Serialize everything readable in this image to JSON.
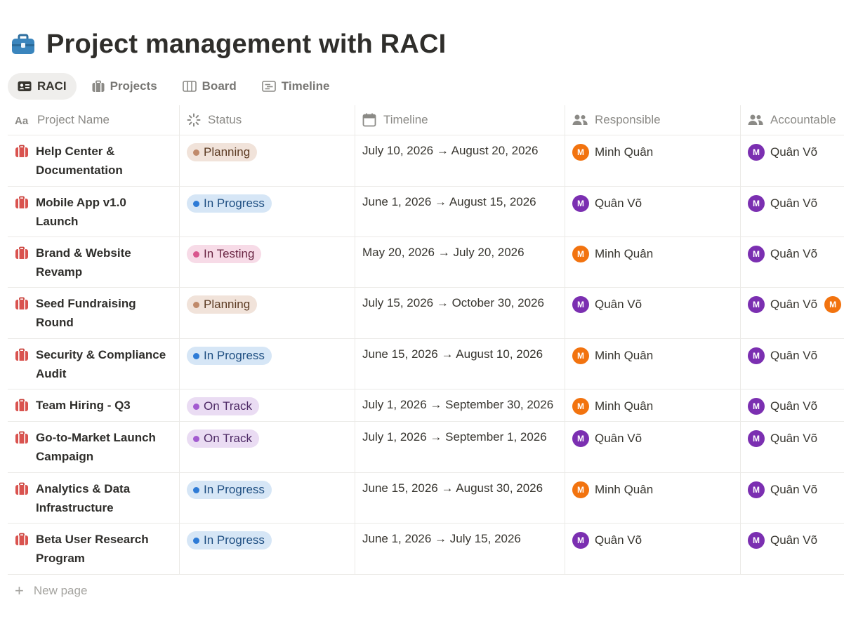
{
  "page": {
    "title": "Project management with RACI",
    "icon": "briefcase-icon"
  },
  "tabs": [
    {
      "label": "RACI",
      "icon": "id-card-icon",
      "active": true
    },
    {
      "label": "Projects",
      "icon": "briefcase-icon",
      "active": false
    },
    {
      "label": "Board",
      "icon": "board-columns-icon",
      "active": false
    },
    {
      "label": "Timeline",
      "icon": "timeline-icon",
      "active": false
    }
  ],
  "columns": [
    {
      "label": "Project Name",
      "icon": "text-aa-icon"
    },
    {
      "label": "Status",
      "icon": "status-loader-icon"
    },
    {
      "label": "Timeline",
      "icon": "calendar-icon"
    },
    {
      "label": "Responsible",
      "icon": "people-icon"
    },
    {
      "label": "Accountable",
      "icon": "people-icon"
    }
  ],
  "rows": [
    {
      "name": "Help Center &\nDocumentation",
      "status": "Planning",
      "timeline": "July 10, 2026 → August 20, 2026",
      "responsible": [
        {
          "initial": "M",
          "name": "Minh Quân",
          "color": "#f2730f"
        }
      ],
      "accountable": [
        {
          "initial": "M",
          "name": "Quân Võ",
          "color": "#7b2fb1"
        }
      ]
    },
    {
      "name": "Mobile App v1.0\nLaunch",
      "status": "In Progress",
      "timeline": "June 1, 2026 → August 15, 2026",
      "responsible": [
        {
          "initial": "M",
          "name": "Quân Võ",
          "color": "#7b2fb1"
        }
      ],
      "accountable": [
        {
          "initial": "M",
          "name": "Quân Võ",
          "color": "#7b2fb1"
        }
      ]
    },
    {
      "name": "Brand & Website\nRevamp",
      "status": "In Testing",
      "timeline": "May 20, 2026 → July 20, 2026",
      "responsible": [
        {
          "initial": "M",
          "name": "Minh Quân",
          "color": "#f2730f"
        }
      ],
      "accountable": [
        {
          "initial": "M",
          "name": "Quân Võ",
          "color": "#7b2fb1"
        }
      ]
    },
    {
      "name": "Seed Fundraising\nRound",
      "status": "Planning",
      "timeline": "July 15, 2026 → October 30, 2026",
      "responsible": [
        {
          "initial": "M",
          "name": "Quân Võ",
          "color": "#7b2fb1"
        }
      ],
      "accountable": [
        {
          "initial": "M",
          "name": "Quân Võ",
          "color": "#7b2fb1"
        },
        {
          "initial": "M",
          "name": "",
          "color": "#f2730f"
        }
      ]
    },
    {
      "name": "Security & Compliance\nAudit",
      "status": "In Progress",
      "timeline": "June 15, 2026 → August 10, 2026",
      "responsible": [
        {
          "initial": "M",
          "name": "Minh Quân",
          "color": "#f2730f"
        }
      ],
      "accountable": [
        {
          "initial": "M",
          "name": "Quân Võ",
          "color": "#7b2fb1"
        }
      ]
    },
    {
      "name": "Team Hiring - Q3",
      "status": "On Track",
      "timeline": "July 1, 2026 → September 30, 2026",
      "responsible": [
        {
          "initial": "M",
          "name": "Minh Quân",
          "color": "#f2730f"
        }
      ],
      "accountable": [
        {
          "initial": "M",
          "name": "Quân Võ",
          "color": "#7b2fb1"
        }
      ]
    },
    {
      "name": "Go-to-Market Launch\nCampaign",
      "status": "On Track",
      "timeline": "July 1, 2026 → September 1, 2026",
      "responsible": [
        {
          "initial": "M",
          "name": "Quân Võ",
          "color": "#7b2fb1"
        }
      ],
      "accountable": [
        {
          "initial": "M",
          "name": "Quân Võ",
          "color": "#7b2fb1"
        }
      ]
    },
    {
      "name": "Analytics & Data\nInfrastructure",
      "status": "In Progress",
      "timeline": "June 15, 2026 → August 30, 2026",
      "responsible": [
        {
          "initial": "M",
          "name": "Minh Quân",
          "color": "#f2730f"
        }
      ],
      "accountable": [
        {
          "initial": "M",
          "name": "Quân Võ",
          "color": "#7b2fb1"
        }
      ]
    },
    {
      "name": "Beta User Research\nProgram",
      "status": "In Progress",
      "timeline": "June 1, 2026 → July 15, 2026",
      "responsible": [
        {
          "initial": "M",
          "name": "Quân Võ",
          "color": "#7b2fb1"
        }
      ],
      "accountable": [
        {
          "initial": "M",
          "name": "Quân Võ",
          "color": "#7b2fb1"
        }
      ]
    }
  ],
  "status_colors": {
    "Planning": {
      "bg": "#f1e3da",
      "dot": "#c08a6b",
      "text": "#5c3b23"
    },
    "In Progress": {
      "bg": "#d6e6f6",
      "dot": "#2e7bd6",
      "text": "#1f4f82"
    },
    "In Testing": {
      "bg": "#f7dbe7",
      "dot": "#d9578e",
      "text": "#6b2744"
    },
    "On Track": {
      "bg": "#eadcf3",
      "dot": "#a35bd0",
      "text": "#4e2a66"
    }
  },
  "new_page": {
    "label": "New page"
  }
}
